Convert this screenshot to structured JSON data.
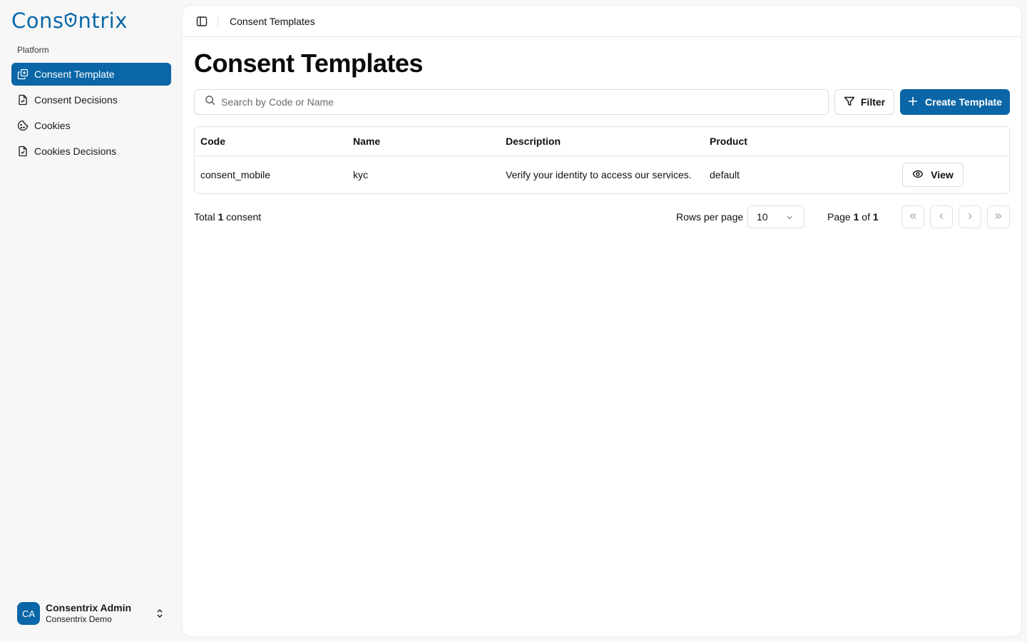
{
  "brand": {
    "logo_text_left": "Cons",
    "logo_text_right": "ntrix",
    "accent_color": "#0a66a6"
  },
  "sidebar": {
    "section_label": "Platform",
    "items": [
      {
        "label": "Consent Template",
        "icon": "templates-icon",
        "active": true
      },
      {
        "label": "Consent Decisions",
        "icon": "file-check-icon",
        "active": false
      },
      {
        "label": "Cookies",
        "icon": "cookie-icon",
        "active": false
      },
      {
        "label": "Cookies Decisions",
        "icon": "file-check-icon",
        "active": false
      }
    ],
    "user": {
      "initials": "CA",
      "name": "Consentrix Admin",
      "org": "Consentrix Demo"
    }
  },
  "topbar": {
    "title": "Consent Templates"
  },
  "page": {
    "title": "Consent Templates"
  },
  "search": {
    "placeholder": "Search by Code or Name",
    "value": ""
  },
  "toolbar": {
    "filter_label": "Filter",
    "create_label": "Create Template"
  },
  "table": {
    "headers": {
      "code": "Code",
      "name": "Name",
      "description": "Description",
      "product": "Product"
    },
    "rows": [
      {
        "code": "consent_mobile",
        "name": "kyc",
        "description": "Verify your identity to access our services.",
        "product": "default",
        "action": "View"
      }
    ]
  },
  "footer": {
    "total_prefix": "Total",
    "total_count": "1",
    "total_suffix": "consent",
    "rows_per_page_label": "Rows per page",
    "rows_per_page_value": "10",
    "page_prefix": "Page",
    "page_current": "1",
    "page_of": "of",
    "page_total": "1"
  }
}
